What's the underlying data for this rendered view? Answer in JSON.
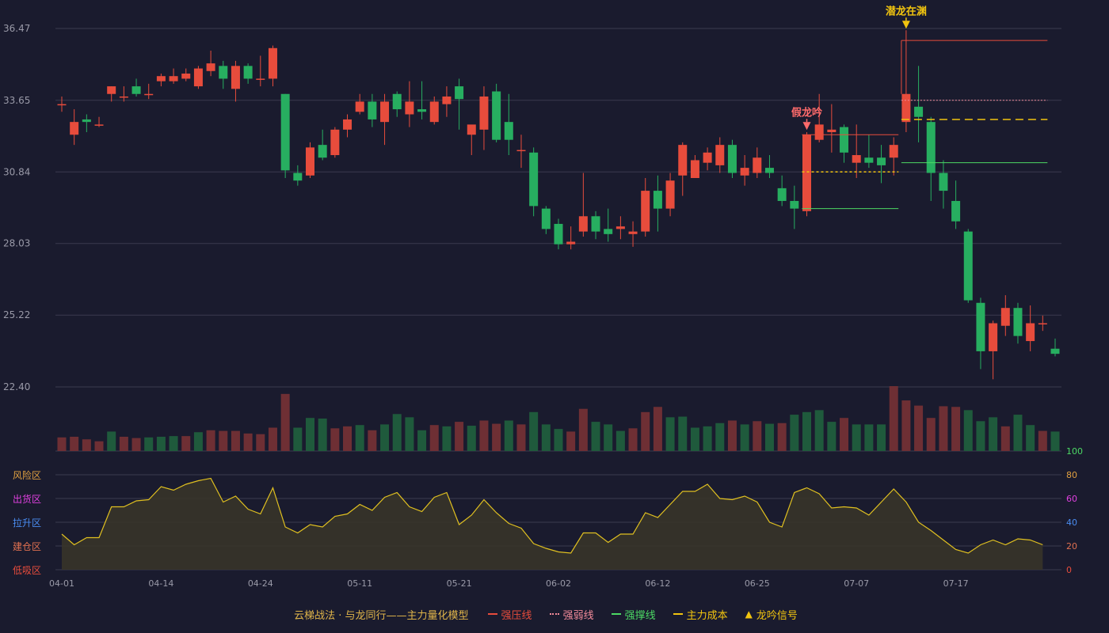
{
  "colors": {
    "background": "#1a1b2e",
    "grid": "#3a3b4e",
    "up": "#e74c3c",
    "down": "#27ae60",
    "up_vol": "#6e2f34",
    "down_vol": "#1f5a3c",
    "axis_text": "#9a9aa8",
    "strong_pressure": "#e74c3c",
    "strong_weak": "#f28b9a",
    "strong_support": "#4cd964",
    "main_cost": "#f1c40f",
    "oscillator_line": "#e0c020",
    "oscillator_fill": "#3a3528",
    "signal_fake": "#ff6b6b",
    "signal_real": "#f1c40f"
  },
  "legend": {
    "title": "云梯战法 · 与龙同行——主力量化模型",
    "items": [
      {
        "label": "强压线",
        "color": "#e74c3c",
        "style": "solid"
      },
      {
        "label": "强弱线",
        "color": "#f28b9a",
        "style": "dotted"
      },
      {
        "label": "强撑线",
        "color": "#4cd964",
        "style": "solid"
      },
      {
        "label": "主力成本",
        "color": "#f1c40f",
        "style": "dashed"
      },
      {
        "label": "龙吟信号",
        "color": "#f1c40f",
        "style": "triangle"
      }
    ]
  },
  "chart_data": {
    "type": "candlestick",
    "price_axis": {
      "ticks": [
        "36.47",
        "33.65",
        "30.84",
        "28.03",
        "25.22",
        "22.40"
      ],
      "ylim": [
        22.4,
        36.47
      ]
    },
    "x_ticks": [
      {
        "index": 0,
        "label": "04-01"
      },
      {
        "index": 8,
        "label": "04-14"
      },
      {
        "index": 16,
        "label": "04-24"
      },
      {
        "index": 24,
        "label": "05-11"
      },
      {
        "index": 32,
        "label": "05-21"
      },
      {
        "index": 40,
        "label": "06-02"
      },
      {
        "index": 48,
        "label": "06-12"
      },
      {
        "index": 56,
        "label": "06-25"
      },
      {
        "index": 64,
        "label": "07-07"
      },
      {
        "index": 72,
        "label": "07-17"
      }
    ],
    "candles": [
      [
        33.5,
        33.5,
        33.8,
        33.2
      ],
      [
        32.3,
        32.8,
        33.3,
        31.9
      ],
      [
        32.9,
        32.8,
        33.1,
        32.4
      ],
      [
        32.7,
        32.7,
        33.0,
        32.6
      ],
      [
        33.9,
        34.2,
        34.2,
        33.6
      ],
      [
        33.8,
        33.8,
        34.2,
        33.6
      ],
      [
        34.2,
        33.9,
        34.5,
        33.8
      ],
      [
        33.9,
        33.9,
        34.3,
        33.7
      ],
      [
        34.4,
        34.6,
        34.7,
        34.2
      ],
      [
        34.4,
        34.6,
        34.9,
        34.3
      ],
      [
        34.5,
        34.7,
        34.9,
        34.4
      ],
      [
        34.2,
        34.9,
        35.0,
        34.1
      ],
      [
        34.8,
        35.1,
        35.6,
        34.6
      ],
      [
        35.0,
        34.5,
        35.2,
        34.1
      ],
      [
        34.1,
        35.0,
        35.2,
        33.6
      ],
      [
        35.0,
        34.5,
        35.1,
        34.3
      ],
      [
        34.5,
        34.5,
        35.4,
        34.2
      ],
      [
        34.5,
        35.7,
        35.8,
        34.2
      ],
      [
        33.9,
        30.9,
        33.9,
        30.6
      ],
      [
        30.8,
        30.5,
        31.1,
        30.3
      ],
      [
        30.7,
        31.8,
        32.0,
        30.6
      ],
      [
        31.9,
        31.4,
        32.5,
        31.3
      ],
      [
        31.5,
        32.5,
        32.6,
        31.4
      ],
      [
        32.5,
        32.9,
        33.1,
        32.2
      ],
      [
        33.2,
        33.6,
        33.9,
        33.1
      ],
      [
        33.6,
        32.9,
        33.9,
        32.6
      ],
      [
        32.8,
        33.6,
        33.9,
        31.9
      ],
      [
        33.9,
        33.3,
        34.0,
        33.0
      ],
      [
        33.1,
        33.6,
        34.4,
        32.6
      ],
      [
        33.3,
        33.2,
        34.4,
        32.9
      ],
      [
        32.8,
        33.6,
        33.8,
        32.7
      ],
      [
        33.5,
        33.8,
        34.2,
        33.0
      ],
      [
        34.2,
        33.7,
        34.5,
        32.5
      ],
      [
        32.3,
        32.7,
        32.6,
        31.5
      ],
      [
        32.5,
        33.8,
        34.2,
        31.7
      ],
      [
        34.0,
        32.1,
        34.3,
        32.0
      ],
      [
        32.8,
        32.1,
        33.9,
        31.5
      ],
      [
        31.7,
        31.7,
        32.3,
        31.0
      ],
      [
        31.6,
        29.5,
        31.8,
        29.1
      ],
      [
        29.4,
        28.6,
        29.5,
        28.4
      ],
      [
        28.8,
        28.0,
        29.0,
        27.8
      ],
      [
        28.0,
        28.1,
        28.7,
        27.8
      ],
      [
        28.5,
        29.1,
        30.8,
        28.3
      ],
      [
        29.1,
        28.5,
        29.3,
        28.2
      ],
      [
        28.6,
        28.4,
        29.4,
        28.1
      ],
      [
        28.6,
        28.7,
        29.1,
        28.2
      ],
      [
        28.4,
        28.5,
        28.9,
        27.9
      ],
      [
        28.5,
        30.1,
        30.6,
        28.3
      ],
      [
        30.1,
        29.4,
        30.7,
        28.5
      ],
      [
        29.4,
        30.5,
        30.8,
        29.1
      ],
      [
        30.7,
        31.9,
        32.0,
        29.9
      ],
      [
        30.6,
        31.3,
        31.5,
        30.7
      ],
      [
        31.2,
        31.6,
        31.8,
        30.9
      ],
      [
        31.1,
        31.9,
        32.2,
        30.8
      ],
      [
        31.9,
        30.8,
        32.1,
        30.6
      ],
      [
        30.7,
        31.0,
        31.5,
        30.3
      ],
      [
        30.8,
        31.4,
        31.8,
        30.6
      ],
      [
        31.0,
        30.8,
        31.5,
        30.6
      ],
      [
        30.2,
        29.7,
        30.7,
        29.5
      ],
      [
        29.7,
        29.4,
        30.3,
        28.6
      ],
      [
        29.3,
        32.3,
        32.4,
        29.1
      ],
      [
        32.1,
        32.7,
        33.9,
        32.0
      ],
      [
        32.4,
        32.5,
        33.5,
        31.6
      ],
      [
        32.6,
        31.6,
        32.7,
        31.2
      ],
      [
        31.2,
        31.5,
        32.7,
        30.6
      ],
      [
        31.4,
        31.2,
        32.3,
        31.0
      ],
      [
        31.4,
        31.1,
        31.9,
        30.4
      ],
      [
        31.4,
        31.9,
        32.2,
        30.7
      ],
      [
        32.8,
        33.9,
        36.4,
        32.4
      ],
      [
        33.4,
        33.0,
        35.0,
        32.0
      ],
      [
        32.8,
        30.8,
        33.0,
        29.7
      ],
      [
        30.8,
        30.1,
        31.3,
        29.4
      ],
      [
        29.7,
        28.9,
        30.5,
        28.6
      ],
      [
        28.5,
        25.8,
        28.6,
        25.7
      ],
      [
        25.7,
        23.8,
        25.9,
        23.1
      ],
      [
        23.8,
        24.9,
        25.0,
        22.7
      ],
      [
        24.8,
        25.5,
        26.0,
        24.4
      ],
      [
        25.5,
        24.4,
        25.7,
        24.1
      ],
      [
        24.2,
        24.9,
        25.6,
        23.8
      ],
      [
        24.9,
        24.9,
        25.2,
        24.6
      ],
      [
        23.9,
        23.7,
        24.3,
        23.6
      ]
    ],
    "volume_up": [
      true,
      true,
      true,
      true,
      false,
      true,
      true,
      false,
      false,
      false,
      true,
      false,
      true,
      true,
      true,
      true,
      true,
      true,
      true,
      false,
      false,
      false,
      true,
      true,
      false,
      true,
      false,
      false,
      false,
      false,
      true,
      false,
      true,
      false,
      true,
      true,
      false,
      true,
      false,
      false,
      false,
      true,
      true,
      false,
      false,
      false,
      true,
      true,
      true,
      false,
      false,
      false,
      false,
      false,
      true,
      false,
      true,
      false,
      true,
      false,
      false,
      false,
      false,
      true,
      false,
      false,
      false,
      true,
      true,
      true,
      true,
      true,
      true,
      false,
      false,
      false,
      true,
      false,
      false,
      true,
      false
    ],
    "volume": [
      0.21,
      0.22,
      0.18,
      0.15,
      0.3,
      0.22,
      0.2,
      0.21,
      0.22,
      0.23,
      0.23,
      0.29,
      0.32,
      0.31,
      0.31,
      0.27,
      0.26,
      0.36,
      0.88,
      0.36,
      0.51,
      0.5,
      0.35,
      0.38,
      0.4,
      0.32,
      0.41,
      0.57,
      0.52,
      0.32,
      0.4,
      0.38,
      0.45,
      0.39,
      0.47,
      0.42,
      0.47,
      0.41,
      0.6,
      0.41,
      0.34,
      0.3,
      0.65,
      0.45,
      0.41,
      0.31,
      0.35,
      0.6,
      0.68,
      0.52,
      0.53,
      0.36,
      0.38,
      0.43,
      0.47,
      0.41,
      0.46,
      0.42,
      0.43,
      0.56,
      0.6,
      0.63,
      0.45,
      0.51,
      0.41,
      0.41,
      0.41,
      1.0,
      0.78,
      0.7,
      0.51,
      0.69,
      0.68,
      0.63,
      0.46,
      0.52,
      0.38,
      0.56,
      0.4,
      0.31,
      0.3
    ],
    "oscillator": {
      "ylim": [
        0,
        100
      ],
      "ticks": [
        "100",
        "80",
        "60",
        "40",
        "20",
        "0"
      ],
      "tick_colors": [
        "#4cd964",
        "#e0a040",
        "#e040e0",
        "#4a8cf0",
        "#e07050",
        "#e74c3c"
      ],
      "zones": [
        {
          "label": "风险区",
          "color": "#e0a040"
        },
        {
          "label": "出货区",
          "color": "#e040e0"
        },
        {
          "label": "拉升区",
          "color": "#4a8cf0"
        },
        {
          "label": "建仓区",
          "color": "#e07050"
        },
        {
          "label": "低吸区",
          "color": "#e74c3c"
        }
      ],
      "values": [
        30,
        21,
        27,
        27,
        53,
        53,
        58,
        59,
        70,
        67,
        72,
        75,
        77,
        57,
        62,
        51,
        47,
        69,
        36,
        31,
        38,
        36,
        45,
        47,
        55,
        50,
        61,
        65,
        53,
        49,
        61,
        65,
        38,
        46,
        59,
        48,
        39,
        35,
        22,
        18,
        15,
        14,
        31,
        31,
        23,
        30,
        30,
        48,
        44,
        55,
        66,
        66,
        72,
        60,
        59,
        62,
        57,
        40,
        36,
        65,
        69,
        64,
        52,
        53,
        52,
        46,
        57,
        68,
        57,
        40,
        33,
        25,
        17,
        14,
        21,
        25,
        21,
        26,
        25,
        21
      ]
    },
    "lines": {
      "pressure_left": {
        "from": 60,
        "to": 67,
        "value": 32.3
      },
      "support_left": {
        "from": 60,
        "to": 67,
        "value": 29.4
      },
      "cost_left": {
        "from": 60,
        "to": 67,
        "value": 30.84
      },
      "pressure_right": {
        "from": 68,
        "to": 79,
        "value": 36.0
      },
      "weak_right": {
        "from": 68,
        "to": 79,
        "value": 33.65
      },
      "cost_right": {
        "from": 68,
        "to": 79,
        "value": 32.9
      },
      "support_right": {
        "from": 68,
        "to": 79,
        "value": 31.2
      }
    },
    "signals": [
      {
        "index": 60,
        "label": "假龙吟",
        "kind": "fake"
      },
      {
        "index": 68,
        "label": "潜龙在渊",
        "kind": "real"
      }
    ]
  }
}
